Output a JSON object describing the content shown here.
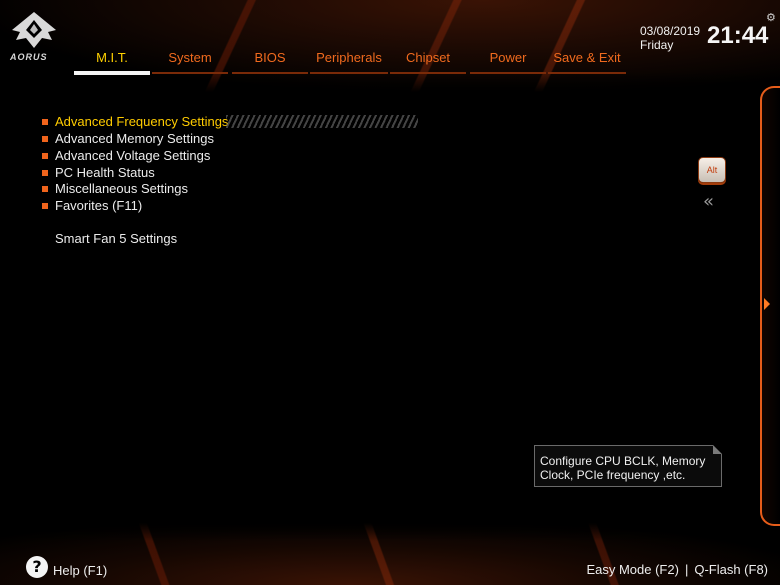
{
  "brand": {
    "logo_text": "AORUS"
  },
  "tabs": [
    {
      "label": "M.I.T.",
      "active": true
    },
    {
      "label": "System"
    },
    {
      "label": "BIOS"
    },
    {
      "label": "Peripherals"
    },
    {
      "label": "Chipset"
    },
    {
      "label": "Power"
    },
    {
      "label": "Save & Exit"
    }
  ],
  "datetime": {
    "date": "03/08/2019",
    "day": "Friday",
    "time": "21:44"
  },
  "menu": {
    "items": [
      {
        "label": "Advanced Frequency Settings",
        "selected": true
      },
      {
        "label": "Advanced Memory Settings"
      },
      {
        "label": "Advanced Voltage Settings"
      },
      {
        "label": "PC Health Status"
      },
      {
        "label": "Miscellaneous Settings"
      },
      {
        "label": "Favorites (F11)"
      }
    ],
    "extra": "Smart Fan 5 Settings"
  },
  "side": {
    "alt_label": "Alt",
    "collapse_glyph": "«"
  },
  "help_box": {
    "line1": "Configure CPU BCLK, Memory",
    "line2": "Clock, PCIe frequency ,etc."
  },
  "footer": {
    "help_icon": "?",
    "help_label": "Help (F1)",
    "easy_mode": "Easy Mode (F2)",
    "separator": "|",
    "qflash": "Q-Flash (F8)"
  },
  "colors": {
    "accent": "#f06a1e",
    "selected": "#ffcc00",
    "background": "#000000"
  }
}
